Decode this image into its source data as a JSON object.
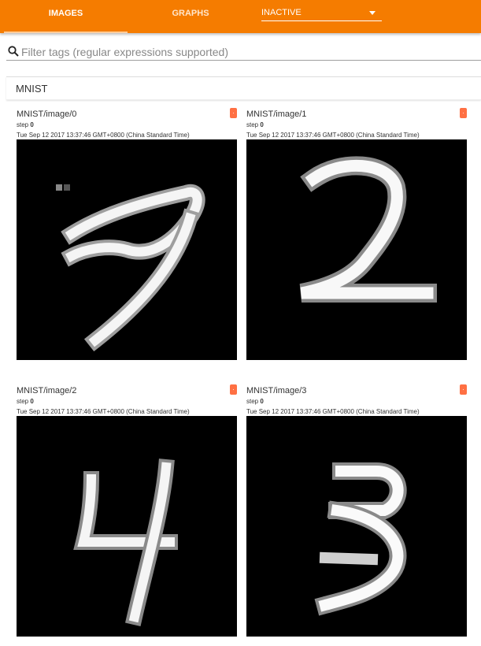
{
  "header": {
    "tabs": [
      {
        "label": "IMAGES"
      },
      {
        "label": "GRAPHS"
      }
    ],
    "run_selector": {
      "value": "INACTIVE"
    }
  },
  "filter": {
    "placeholder": "Filter tags (regular expressions supported)"
  },
  "category": {
    "title": "MNIST"
  },
  "cards": [
    {
      "tag": "MNIST/image/0",
      "step_label": "step",
      "step_value": "0",
      "timestamp": "Tue Sep 12 2017 13:37:46 GMT+0800 (China Standard Time)",
      "badge": "·"
    },
    {
      "tag": "MNIST/image/1",
      "step_label": "step",
      "step_value": "0",
      "timestamp": "Tue Sep 12 2017 13:37:46 GMT+0800 (China Standard Time)",
      "badge": "·"
    },
    {
      "tag": "MNIST/image/2",
      "step_label": "step",
      "step_value": "0",
      "timestamp": "Tue Sep 12 2017 13:37:46 GMT+0800 (China Standard Time)",
      "badge": "·"
    },
    {
      "tag": "MNIST/image/3",
      "step_label": "step",
      "step_value": "0",
      "timestamp": "Tue Sep 12 2017 13:37:46 GMT+0800 (China Standard Time)",
      "badge": "·"
    }
  ],
  "colors": {
    "accent": "#f57c00",
    "badge": "#ff7043"
  }
}
